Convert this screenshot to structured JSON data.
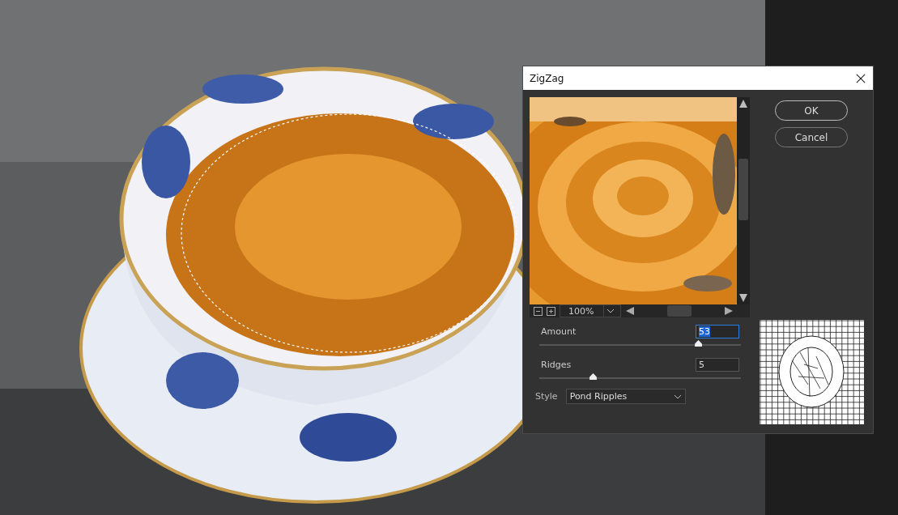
{
  "dialog": {
    "title": "ZigZag",
    "buttons": [
      "OK",
      "Cancel"
    ],
    "preview": {
      "zoom": "100%"
    },
    "fields": [
      {
        "label": "Amount",
        "value": "53",
        "level": 0.77,
        "focused": true
      },
      {
        "label": "Ridges",
        "value": "5",
        "level": 0.25,
        "focused": false
      }
    ],
    "style": {
      "label": "Style",
      "value": "Pond Ripples"
    }
  }
}
